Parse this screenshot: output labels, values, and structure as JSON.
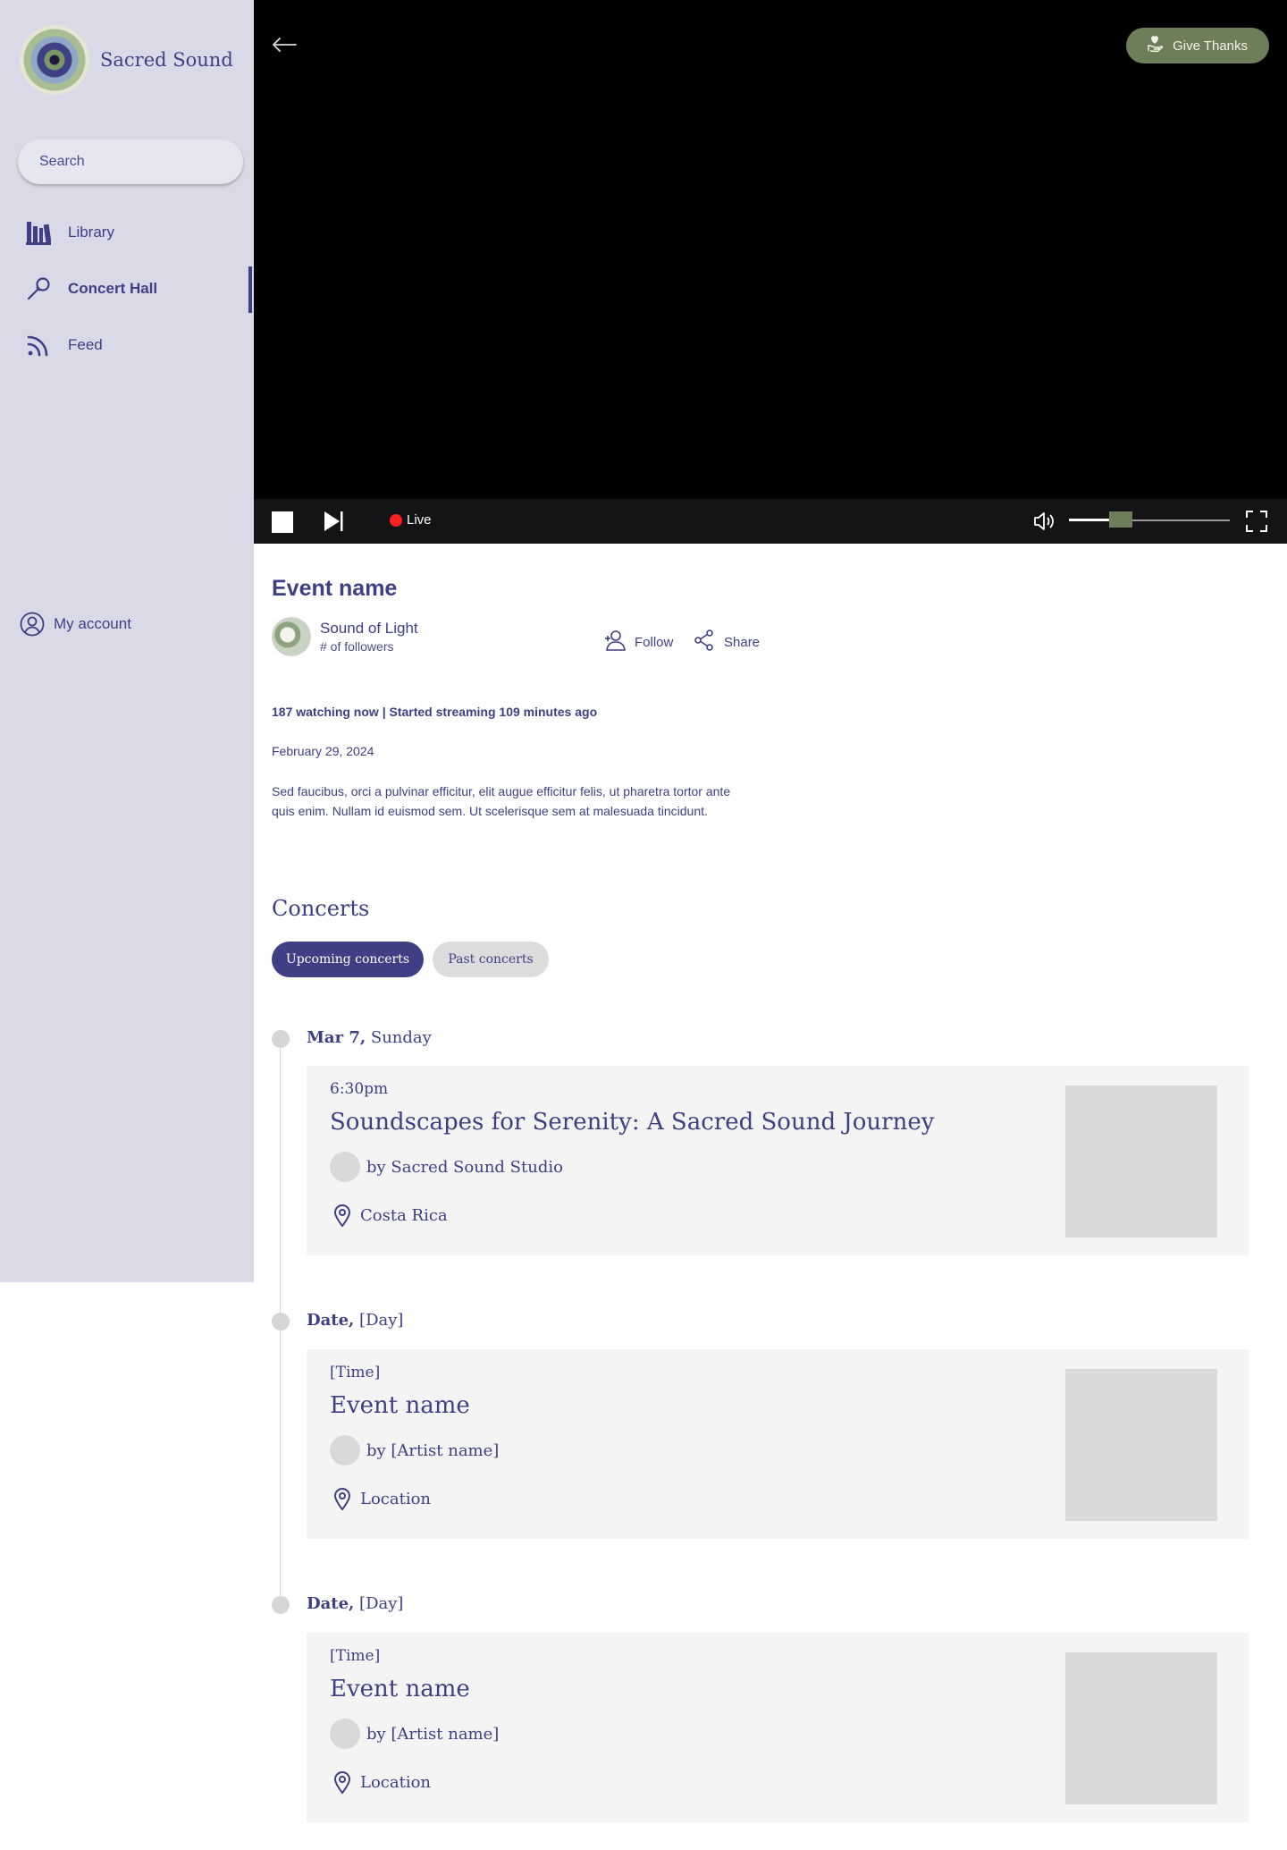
{
  "app": {
    "brand": "Sacred Sound"
  },
  "search": {
    "placeholder": "Search"
  },
  "sidebar": {
    "items": [
      {
        "label": "Library",
        "icon": "library-icon"
      },
      {
        "label": "Concert Hall",
        "icon": "tuning-fork-icon",
        "active": true
      },
      {
        "label": "Feed",
        "icon": "feed-icon"
      }
    ],
    "account": {
      "label": "My account",
      "icon": "user-circle-icon"
    }
  },
  "player": {
    "give_thanks": "Give Thanks",
    "live_label": "Live",
    "volume_level": 0.25,
    "colors": {
      "accent": "#6d7f5a",
      "live": "#ff2020"
    }
  },
  "event": {
    "title": "Event name",
    "artist": "Sound of Light",
    "followers": "# of followers",
    "follow_label": "Follow",
    "share_label": "Share",
    "stats": "187 watching now | Started streaming 109 minutes ago",
    "date": "February 29, 2024",
    "description": "Sed faucibus, orci a pulvinar efficitur, elit augue efficitur felis, ut pharetra tortor ante quis enim. Nullam id euismod sem. Ut scelerisque sem at malesuada tincidunt."
  },
  "concerts": {
    "title": "Concerts",
    "tabs": [
      "Upcoming concerts",
      "Past concerts"
    ],
    "items": [
      {
        "date": "Mar 7,",
        "day": "Sunday",
        "time": "6:30pm",
        "title": "Soundscapes for Serenity: A Sacred Sound Journey",
        "by": "by Sacred Sound Studio",
        "location": "Costa Rica"
      },
      {
        "date": "Date,",
        "day": "[Day]",
        "time": "[Time]",
        "title": "Event name",
        "by": "by [Artist name]",
        "location": "Location"
      },
      {
        "date": "Date,",
        "day": "[Day]",
        "time": "[Time]",
        "title": "Event name",
        "by": "by [Artist name]",
        "location": "Location"
      }
    ]
  },
  "colors": {
    "primary": "#3f3f85",
    "sidebar_bg": "#dad9e8"
  }
}
